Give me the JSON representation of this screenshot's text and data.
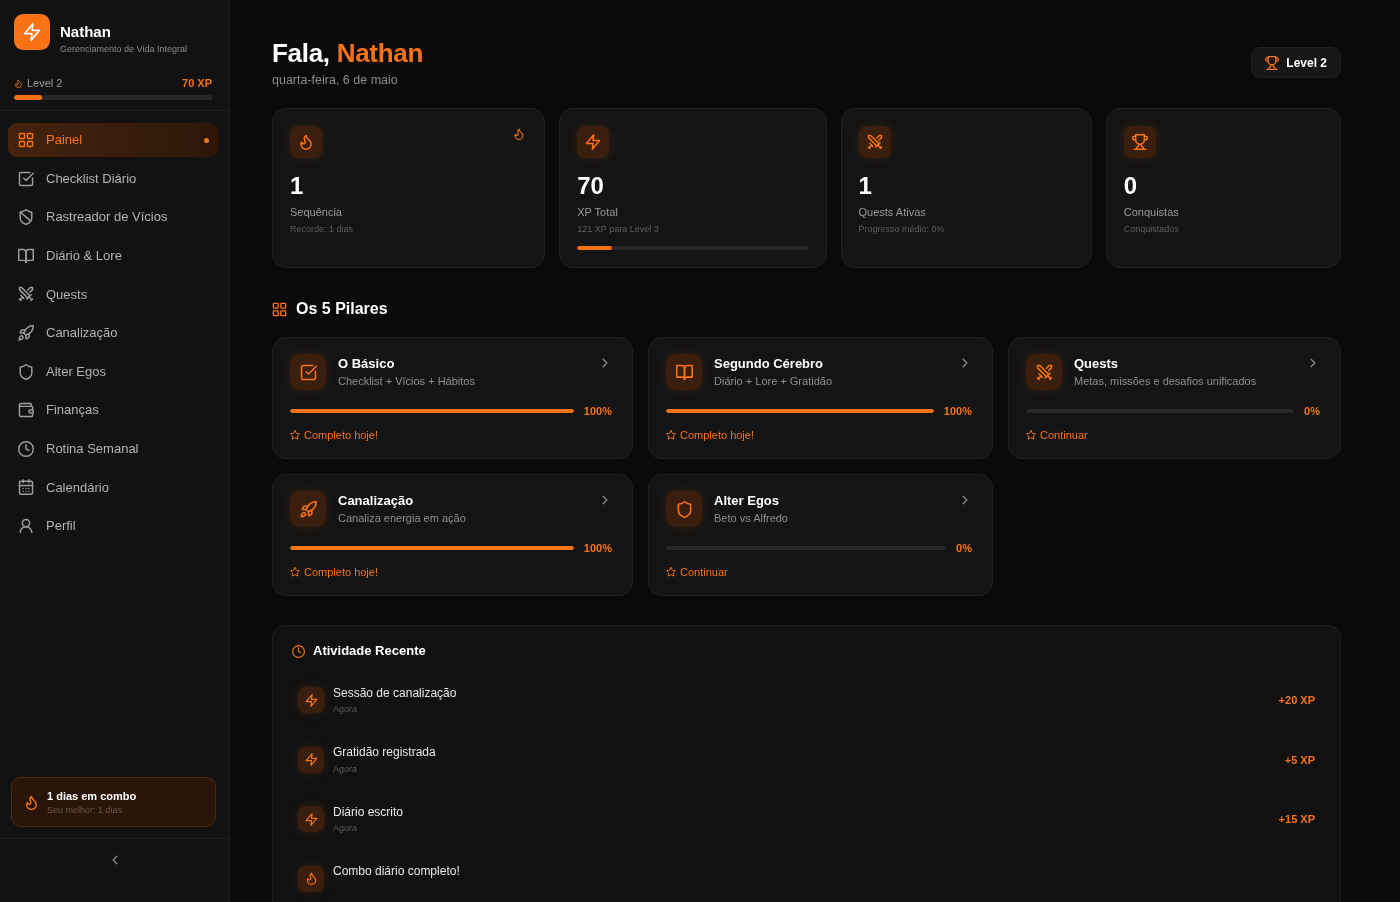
{
  "sidebar": {
    "brand": {
      "name": "Nathan",
      "tagline": "Gerenciamento de Vida Integral"
    },
    "progress": {
      "label": "Level 2",
      "xp": "70 XP",
      "level": 0.14
    },
    "nav_items": [
      {
        "label": "Painel",
        "selected": true
      },
      {
        "label": "Checklist Diário",
        "selected": false
      },
      {
        "label": "Rastreador de Vícios",
        "selected": false
      },
      {
        "label": "Diário & Lore",
        "selected": false
      },
      {
        "label": "Quests",
        "selected": false
      },
      {
        "label": "Canalização",
        "selected": false
      },
      {
        "label": "Alter Egos",
        "selected": false
      },
      {
        "label": "Finanças",
        "selected": false
      },
      {
        "label": "Rotina Semanal",
        "selected": false
      },
      {
        "label": "Calendário",
        "selected": false
      },
      {
        "label": "Perfil",
        "selected": false
      }
    ],
    "combo": {
      "title": "1 dias em combo",
      "subtitle": "Seu melhor: 1 dias"
    }
  },
  "header": {
    "greeting": "Fala,",
    "name": "Nathan",
    "date": "quarta-feira, 6 de maio",
    "level_badge": "Level 2"
  },
  "stats": [
    {
      "value": "1",
      "label": "Sequência",
      "detail": "Recorde: 1 dias"
    },
    {
      "value": "70",
      "label": "XP Total",
      "detail": "121 XP para Level 3",
      "level": 0.15
    },
    {
      "value": "1",
      "label": "Quests Ativas",
      "detail": "Progresso médio: 0%"
    },
    {
      "value": "0",
      "label": "Conquistas",
      "detail": "Conquistados"
    }
  ],
  "pillars": {
    "title": "Os 5 Pilares",
    "items": [
      {
        "title": "O Básico",
        "subtitle": "Checklist + Vícios + Hábitos",
        "level": 1,
        "percent": "100%",
        "status": "Completo hoje!"
      },
      {
        "title": "Segundo Cérebro",
        "subtitle": "Diário + Lore + Gratidão",
        "level": 1,
        "percent": "100%",
        "status": "Completo hoje!"
      },
      {
        "title": "Quests",
        "subtitle": "Metas, missões e desafios unificados",
        "level": 0,
        "percent": "0%",
        "status": "Continuar"
      },
      {
        "title": "Canalização",
        "subtitle": "Canaliza energia em ação",
        "level": 1,
        "percent": "100%",
        "status": "Completo hoje!"
      },
      {
        "title": "Alter Egos",
        "subtitle": "Beto vs Alfredo",
        "level": 0,
        "percent": "0%",
        "status": "Continuar"
      }
    ]
  },
  "activity": {
    "title": "Atividade Recente",
    "items": [
      {
        "kind": "xp",
        "title": "Sessão de canalização",
        "time": "Agora",
        "xp": "+20 XP"
      },
      {
        "kind": "xp",
        "title": "Gratidão registrada",
        "time": "Agora",
        "xp": "+5 XP"
      },
      {
        "kind": "xp",
        "title": "Diário escrito",
        "time": "Agora",
        "xp": "+15 XP"
      },
      {
        "kind": "streak",
        "title": "Combo diário completo!"
      }
    ]
  }
}
